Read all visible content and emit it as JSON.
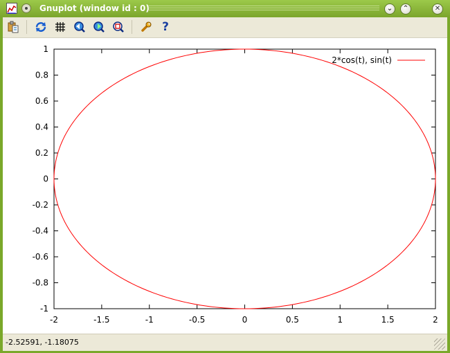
{
  "window": {
    "title": "Gnuplot (window id : 0)"
  },
  "toolbar": {
    "buttons": [
      {
        "name": "copy-to-clipboard-button",
        "icon": "clipboard-icon"
      },
      {
        "name": "replot-button",
        "icon": "refresh-icon"
      },
      {
        "name": "grid-button",
        "icon": "grid-icon"
      },
      {
        "name": "previous-zoom-button",
        "icon": "zoom-previous-icon"
      },
      {
        "name": "next-zoom-button",
        "icon": "zoom-next-icon"
      },
      {
        "name": "autoscale-button",
        "icon": "autoscale-icon"
      },
      {
        "name": "options-button",
        "icon": "wrench-icon"
      },
      {
        "name": "help-button",
        "icon": "help-icon",
        "label": "?"
      }
    ]
  },
  "chart_data": {
    "type": "line",
    "series": [
      {
        "name": "2*cos(t), sin(t)",
        "parametric": "x=2*cos(t), y=sin(t)",
        "color": "#ff0000"
      }
    ],
    "xlim": [
      -2,
      2
    ],
    "ylim": [
      -1,
      1
    ],
    "xticks": [
      "-2",
      "-1.5",
      "-1",
      "-0.5",
      "0",
      "0.5",
      "1",
      "1.5",
      "2"
    ],
    "yticks": [
      "-1",
      "-0.8",
      "-0.6",
      "-0.4",
      "-0.2",
      "0",
      "0.2",
      "0.4",
      "0.6",
      "0.8",
      "1"
    ],
    "grid": false,
    "legend": "top-right"
  },
  "status": {
    "coordinates": "-2.52591, -1.18075"
  }
}
